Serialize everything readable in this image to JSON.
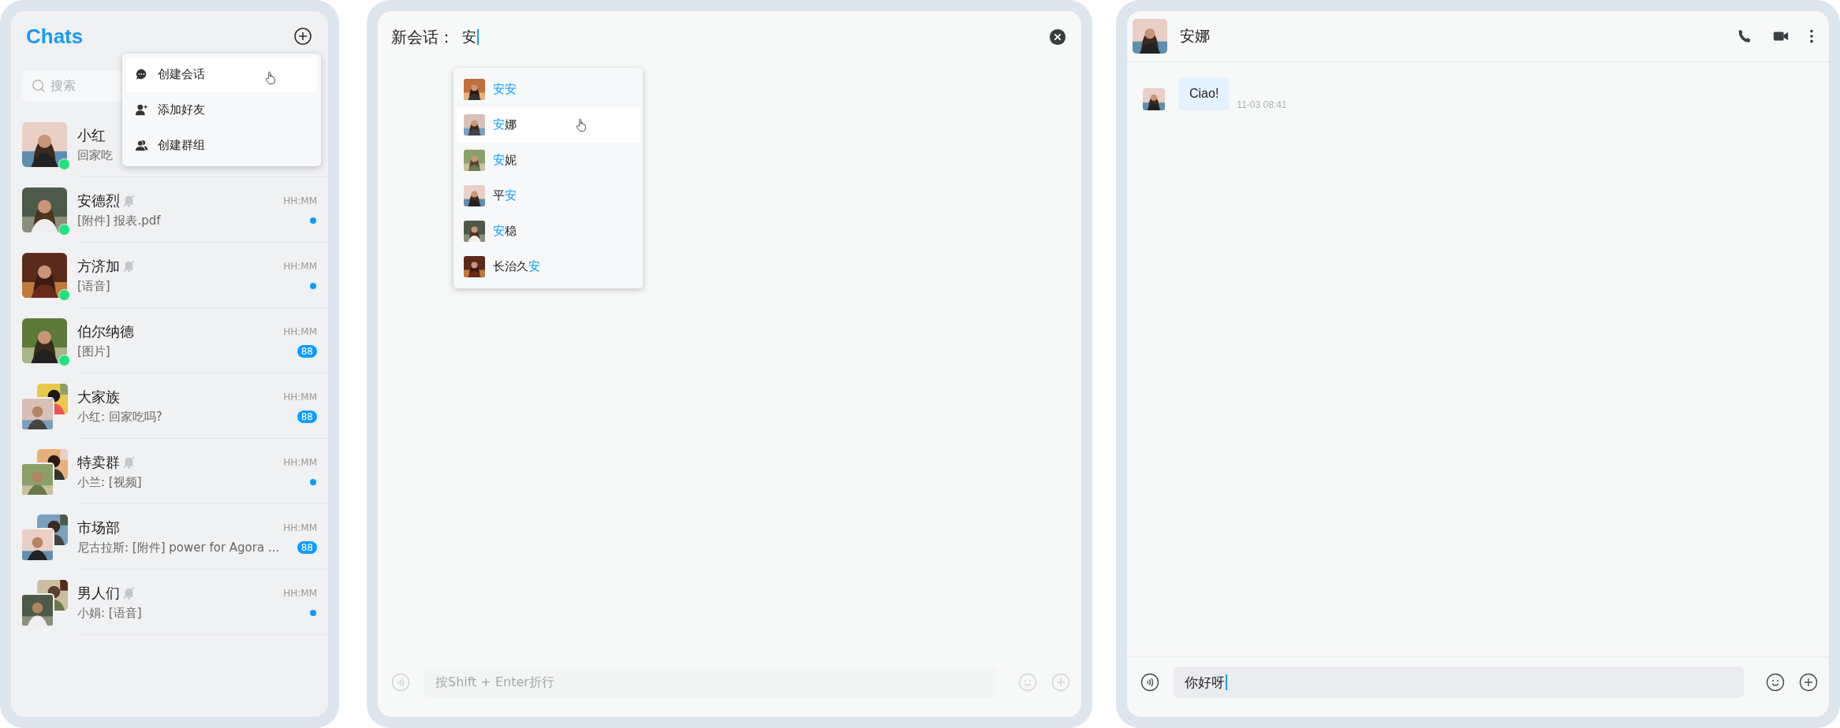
{
  "chats_panel": {
    "title": "Chats",
    "search": {
      "placeholder": "搜索"
    },
    "menu": {
      "items": [
        {
          "label": "创建会话",
          "selected": true
        },
        {
          "label": "添加好友",
          "selected": false
        },
        {
          "label": "创建群组",
          "selected": false
        }
      ]
    },
    "conversations": [
      {
        "name": "小红",
        "preview": "回家吃",
        "kind": "single",
        "online": true,
        "muted": false
      },
      {
        "name": "安德烈",
        "preview": "[附件] 报表.pdf",
        "time": "HH:MM",
        "kind": "single",
        "online": true,
        "muted": true,
        "unread": {
          "kind": "dot"
        }
      },
      {
        "name": "方济加",
        "preview": "[语音]",
        "time": "HH:MM",
        "kind": "single",
        "online": true,
        "muted": true,
        "unread": {
          "kind": "dot"
        }
      },
      {
        "name": "伯尔纳德",
        "preview": "[图片]",
        "time": "HH:MM",
        "kind": "single",
        "online": true,
        "muted": false,
        "unread": {
          "kind": "badge",
          "count": "88"
        }
      },
      {
        "name": "大家族",
        "preview": "小红: 回家吃吗?",
        "time": "HH:MM",
        "kind": "group",
        "online": false,
        "muted": false,
        "unread": {
          "kind": "badge",
          "count": "88"
        }
      },
      {
        "name": "特卖群",
        "preview": "小兰: [视频]",
        "time": "HH:MM",
        "kind": "group",
        "online": false,
        "muted": true,
        "unread": {
          "kind": "dot"
        }
      },
      {
        "name": "市场部",
        "preview": "尼古拉斯: [附件] power for Agora ...",
        "time": "HH:MM",
        "kind": "group",
        "online": false,
        "muted": false,
        "unread": {
          "kind": "badge",
          "count": "88"
        }
      },
      {
        "name": "男人们",
        "preview": "小娟: [语音]",
        "time": "HH:MM",
        "kind": "group",
        "online": false,
        "muted": true,
        "unread": {
          "kind": "dot"
        }
      }
    ]
  },
  "new_chat": {
    "label": "新会话：",
    "value": "安",
    "suggestions": [
      {
        "parts": [
          {
            "text": "安",
            "match": true
          },
          {
            "text": "安",
            "match": true
          }
        ],
        "selected": false
      },
      {
        "parts": [
          {
            "text": "安",
            "match": true
          },
          {
            "text": "娜",
            "match": false
          }
        ],
        "selected": true
      },
      {
        "parts": [
          {
            "text": "安",
            "match": true
          },
          {
            "text": "妮",
            "match": false
          }
        ],
        "selected": false
      },
      {
        "parts": [
          {
            "text": "平",
            "match": false
          },
          {
            "text": "安",
            "match": true
          }
        ],
        "selected": false
      },
      {
        "parts": [
          {
            "text": "安",
            "match": true
          },
          {
            "text": "稳",
            "match": false
          }
        ],
        "selected": false
      },
      {
        "parts": [
          {
            "text": "长治久",
            "match": false
          },
          {
            "text": "安",
            "match": true
          }
        ],
        "selected": false
      }
    ],
    "composer": {
      "placeholder": "按Shift + Enter折行",
      "disabled": true
    }
  },
  "chat": {
    "contact": "安娜",
    "messages": [
      {
        "text": "Ciao!",
        "time": "11-03 08:41"
      }
    ],
    "composer": {
      "value": "你好呀",
      "disabled": false
    }
  }
}
